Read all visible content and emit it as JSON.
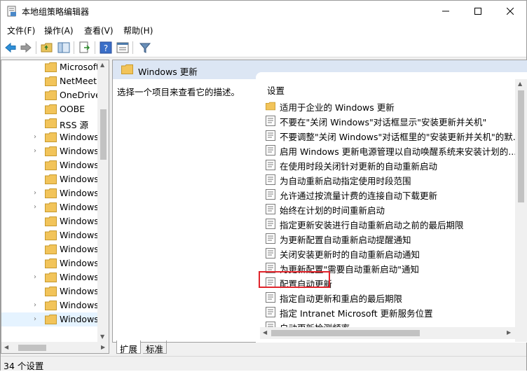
{
  "window": {
    "title": "本地组策略编辑器"
  },
  "menu": [
    "文件(F)",
    "操作(A)",
    "查看(V)",
    "帮助(H)"
  ],
  "tree": {
    "items": [
      {
        "label": "Microsoft",
        "expandable": false,
        "selected": false
      },
      {
        "label": "NetMeeting",
        "expandable": false,
        "selected": false
      },
      {
        "label": "OneDrive",
        "expandable": false,
        "selected": false
      },
      {
        "label": "OOBE",
        "expandable": false,
        "selected": false
      },
      {
        "label": "RSS 源",
        "expandable": false,
        "selected": false
      },
      {
        "label": "Windows",
        "expandable": true,
        "selected": false
      },
      {
        "label": "Windows",
        "expandable": true,
        "selected": false
      },
      {
        "label": "Windows",
        "expandable": false,
        "selected": false
      },
      {
        "label": "Windows",
        "expandable": false,
        "selected": false
      },
      {
        "label": "Windows",
        "expandable": true,
        "selected": false
      },
      {
        "label": "Windows",
        "expandable": true,
        "selected": false
      },
      {
        "label": "Windows",
        "expandable": false,
        "selected": false
      },
      {
        "label": "Windows",
        "expandable": false,
        "selected": false
      },
      {
        "label": "Windows",
        "expandable": false,
        "selected": false
      },
      {
        "label": "Windows",
        "expandable": false,
        "selected": false
      },
      {
        "label": "Windows",
        "expandable": true,
        "selected": false
      },
      {
        "label": "Windows",
        "expandable": false,
        "selected": false
      },
      {
        "label": "Windows",
        "expandable": true,
        "selected": false
      },
      {
        "label": "Windows",
        "expandable": true,
        "selected": true
      }
    ]
  },
  "pane": {
    "header": "Windows 更新",
    "description": "选择一个项目来查看它的描述。",
    "column_header": "设置",
    "settings": [
      {
        "label": "适用于企业的 Windows 更新",
        "type": "folder"
      },
      {
        "label": "不要在\"关闭 Windows\"对话框显示\"安装更新并关机\"",
        "type": "policy"
      },
      {
        "label": "不要调整\"关闭 Windows\"对话框里的\"安装更新并关机\"的默...",
        "type": "policy"
      },
      {
        "label": "启用 Windows 更新电源管理以自动唤醒系统来安装计划的...",
        "type": "policy"
      },
      {
        "label": "在使用时段关闭针对更新的自动重新启动",
        "type": "policy"
      },
      {
        "label": "为自动重新启动指定使用时段范围",
        "type": "policy"
      },
      {
        "label": "允许通过按流量计费的连接自动下载更新",
        "type": "policy"
      },
      {
        "label": "始终在计划的时间重新启动",
        "type": "policy"
      },
      {
        "label": "指定更新安装进行自动重新启动之前的最后期限",
        "type": "policy"
      },
      {
        "label": "为更新配置自动重新启动提醒通知",
        "type": "policy"
      },
      {
        "label": "关闭安装更新时的自动重新启动通知",
        "type": "policy"
      },
      {
        "label": "为更新配置\"需要自动重新启动\"通知",
        "type": "policy"
      },
      {
        "label": "配置自动更新",
        "type": "policy"
      },
      {
        "label": "指定自动更新和重启的最后期限",
        "type": "policy"
      },
      {
        "label": "指定 Intranet Microsoft 更新服务位置",
        "type": "policy"
      },
      {
        "label": "自动更新检测频率",
        "type": "policy"
      }
    ]
  },
  "tabs": [
    "扩展",
    "标准"
  ],
  "status": {
    "text": "34 个设置"
  },
  "colors": {
    "highlight_border": "#e0242b",
    "header_bg": "#dce6f4",
    "folder": "#f2c45a"
  }
}
